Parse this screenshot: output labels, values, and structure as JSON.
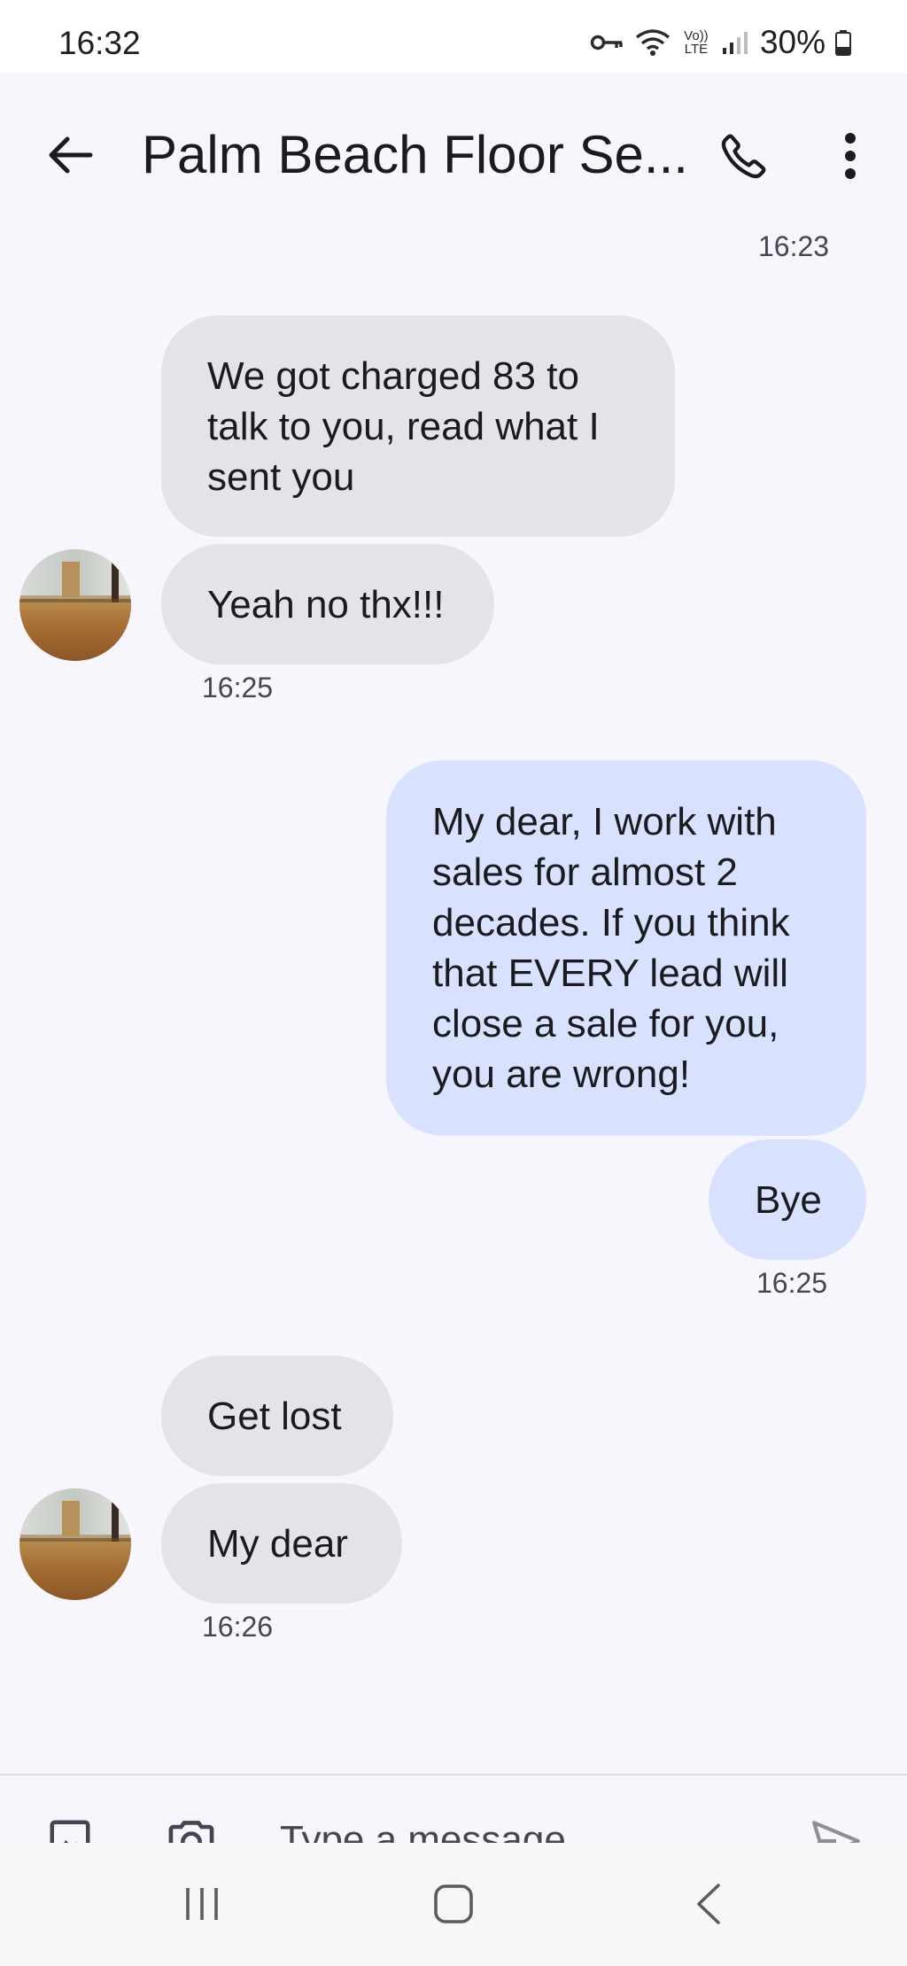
{
  "status_bar": {
    "time": "16:32",
    "network_label": "Vo)) LTE",
    "battery": "30%"
  },
  "header": {
    "title": "Palm Beach Floor Se...",
    "back_icon": "arrow-back-icon",
    "call_icon": "phone-icon",
    "menu_icon": "more-vert-icon"
  },
  "messages": [
    {
      "direction": "incoming",
      "lines": [
        "We got charged 83 to",
        "talk to you, read what I",
        "sent you"
      ]
    },
    {
      "direction": "incoming",
      "lines": [
        "Yeah no thx!!!"
      ]
    },
    {
      "direction": "outgoing",
      "lines": [
        "My dear, I work with",
        "sales for almost 2",
        "decades. If you think",
        "that EVERY lead will",
        "close a sale for you,",
        "you are wrong!"
      ]
    },
    {
      "direction": "outgoing",
      "lines": [
        "Bye"
      ]
    },
    {
      "direction": "incoming",
      "lines": [
        "Get lost"
      ]
    },
    {
      "direction": "incoming",
      "lines": [
        "My dear"
      ]
    }
  ],
  "timestamps": {
    "top_partial": "16:23",
    "after_yeah": "16:25",
    "after_bye": "16:25",
    "after_mydear": "16:26"
  },
  "composer": {
    "placeholder": "Type a message",
    "value": "",
    "gallery_icon": "image-icon",
    "camera_icon": "camera-icon",
    "send_icon": "send-icon"
  },
  "colors": {
    "incoming_bubble": "#e4e3e8",
    "outgoing_bubble": "#d8e2ff",
    "background": "#f7f6fd"
  }
}
